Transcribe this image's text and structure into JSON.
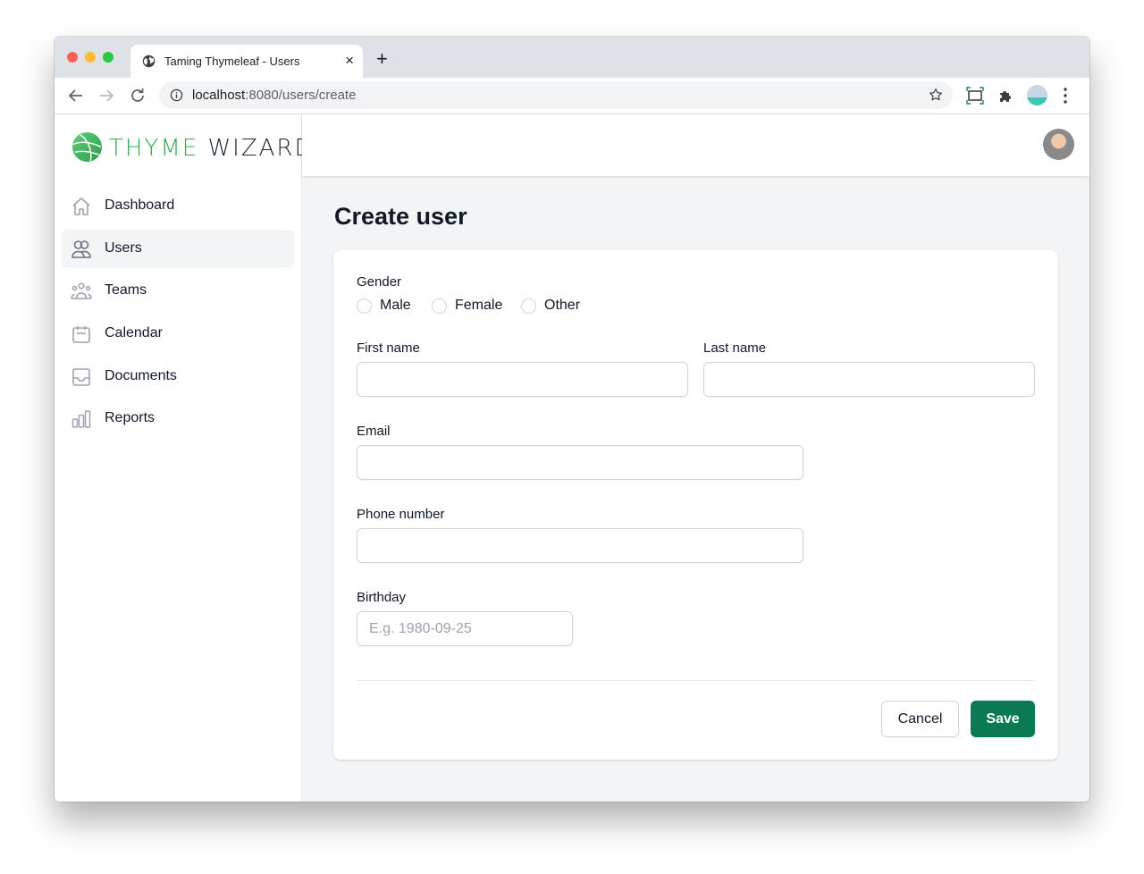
{
  "browser": {
    "tab_title": "Taming Thymeleaf - Users",
    "tab_close_glyph": "×",
    "new_tab_glyph": "+",
    "url_host": "localhost",
    "url_rest": ":8080/users/create",
    "icons": [
      "globe-icon",
      "back-icon",
      "forward-icon",
      "reload-icon",
      "info-icon",
      "bookmark-star-icon",
      "screen-capture-icon",
      "extensions-puzzle-icon",
      "profile-avatar",
      "menu-kebab-icon"
    ]
  },
  "app": {
    "logo": {
      "part1": "THYME",
      "part2": "WIZARDS",
      "accent": "#34a853"
    },
    "sidebar": {
      "items": [
        {
          "label": "Dashboard",
          "icon": "home-icon",
          "active": false
        },
        {
          "label": "Users",
          "icon": "users-icon",
          "active": true
        },
        {
          "label": "Teams",
          "icon": "user-group-icon",
          "active": false
        },
        {
          "label": "Calendar",
          "icon": "calendar-icon",
          "active": false
        },
        {
          "label": "Documents",
          "icon": "inbox-icon",
          "active": false
        },
        {
          "label": "Reports",
          "icon": "chart-bar-icon",
          "active": false
        }
      ]
    },
    "page_title": "Create user",
    "form": {
      "gender": {
        "label": "Gender",
        "options": [
          "Male",
          "Female",
          "Other"
        ],
        "selected": null
      },
      "first_name": {
        "label": "First name",
        "value": "",
        "placeholder": ""
      },
      "last_name": {
        "label": "Last name",
        "value": "",
        "placeholder": ""
      },
      "email": {
        "label": "Email",
        "value": "",
        "placeholder": ""
      },
      "phone": {
        "label": "Phone number",
        "value": "",
        "placeholder": ""
      },
      "birthday": {
        "label": "Birthday",
        "value": "",
        "placeholder": "E.g. 1980-09-25"
      },
      "cancel_label": "Cancel",
      "save_label": "Save"
    },
    "colors": {
      "primary": "#0b7a53",
      "active_nav_bg": "#f3f4f6"
    }
  }
}
